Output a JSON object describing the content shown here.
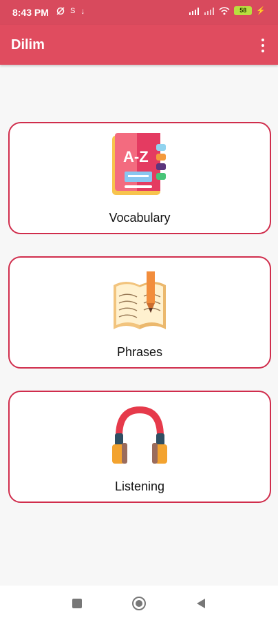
{
  "status_bar": {
    "time": "8:43 PM",
    "battery": "58"
  },
  "app_bar": {
    "title": "Dilim",
    "menu_icon": "more-vertical-icon"
  },
  "cards": [
    {
      "label": "Vocabulary",
      "icon": "a-z-dictionary-book-icon",
      "icon_text": "A-Z"
    },
    {
      "label": "Phrases",
      "icon": "open-book-pencil-icon"
    },
    {
      "label": "Listening",
      "icon": "headphones-icon"
    }
  ],
  "navigation": {
    "recent_icon": "square-icon",
    "home_icon": "circle-home-icon",
    "back_icon": "triangle-back-icon"
  },
  "colors": {
    "primary": "#e04c5f",
    "card_border": "#d02d4c",
    "background": "#f7f7f7"
  }
}
